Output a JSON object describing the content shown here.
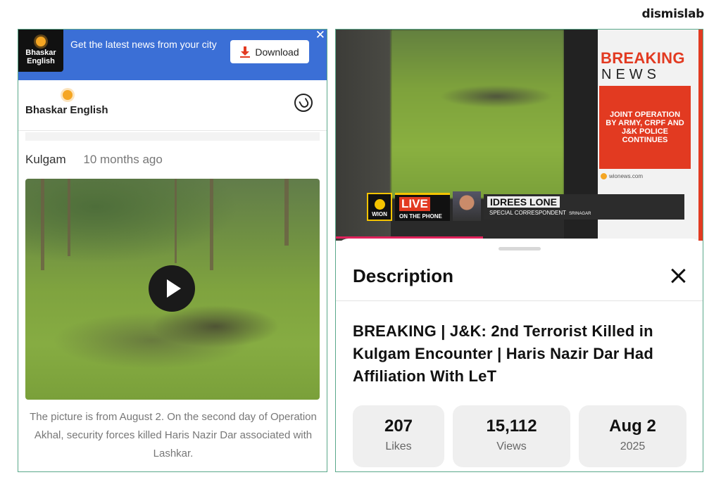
{
  "watermark": "dismislab",
  "left": {
    "banner": {
      "logo_line1": "Bhaskar",
      "logo_line2": "English",
      "text": "Get the latest news from your city",
      "download_label": "Download",
      "close_glyph": "✕"
    },
    "header": {
      "logo_text": "Bhaskar English",
      "share_icon": "whatsapp-icon"
    },
    "article": {
      "location": "Kulgam",
      "time_ago": "10 months ago",
      "caption": "The picture is from August 2. On the second day of Operation Akhal, security forces killed Haris Nazir Dar associated with Lashkar."
    }
  },
  "right": {
    "video": {
      "breaking": "BREAKING",
      "news_word": "NEWS",
      "red_box_text": "JOINT OPERATION BY ARMY, CRPF AND J&K POLICE CONTINUES",
      "source_url": "wionews.com",
      "channel_logo": "WION",
      "live_label": "LIVE",
      "on_phone_label": "ON THE PHONE",
      "reporter_name": "IDREES LONE",
      "reporter_role": "SPECIAL CORRESPONDENT",
      "reporter_city": "SRINAGAR",
      "progress": 0.4
    },
    "sheet": {
      "title": "Description",
      "video_title": "BREAKING | J&K: 2nd Terrorist Killed in Kulgam Encounter | Haris Nazir Dar Had Affiliation With LeT",
      "stats": [
        {
          "value": "207",
          "label": "Likes"
        },
        {
          "value": "15,112",
          "label": "Views"
        },
        {
          "value": "Aug 2",
          "label": "2025"
        }
      ]
    }
  },
  "colors": {
    "banner_blue": "#3b6fd6",
    "news_red": "#e23a21",
    "panel_border": "#5aa88a",
    "progress_pink": "#e0215b"
  }
}
